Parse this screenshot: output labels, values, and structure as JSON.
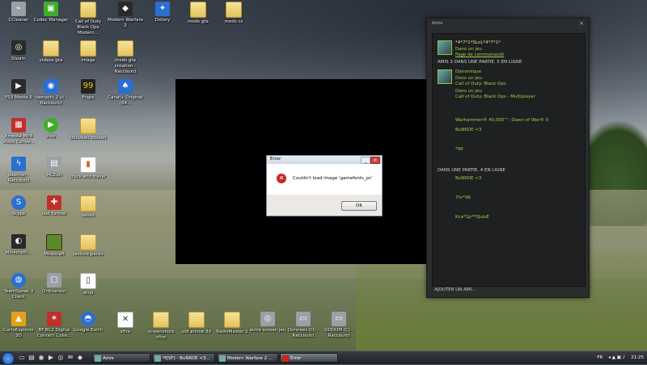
{
  "desktop_icons": [
    {
      "id": "ccleaner",
      "label": "CCleaner",
      "icon": "broom-icon"
    },
    {
      "id": "carboncopy",
      "label": "Codec Manager",
      "icon": "app-icon"
    },
    {
      "id": "cod",
      "label": "Call of Duty Black Ops Modern...",
      "icon": "folder-icon"
    },
    {
      "id": "mw",
      "label": "Modern Warfare 2",
      "icon": "game-icon"
    },
    {
      "id": "dxtory",
      "label": "Dxtory",
      "icon": "app-icon"
    },
    {
      "id": "mods",
      "label": "mods gta",
      "icon": "folder-icon"
    },
    {
      "id": "modcs",
      "label": "mods cs",
      "icon": "folder-icon"
    },
    {
      "id": "steam",
      "label": "Steam",
      "icon": "steam-icon"
    },
    {
      "id": "videos",
      "label": "videos gta",
      "icon": "folder-icon"
    },
    {
      "id": "image",
      "label": "image",
      "icon": "folder-icon"
    },
    {
      "id": "mods_gta_creation",
      "label": "mods gta creation - Raccourci",
      "icon": "folder-icon"
    },
    {
      "id": "ps3",
      "label": "PS3 Media 5",
      "icon": "app-icon"
    },
    {
      "id": "hamachi",
      "label": "hamachi 2 ui - Raccourci",
      "icon": "app-icon"
    },
    {
      "id": "fraps",
      "label": "Fraps",
      "icon": "fraps-icon"
    },
    {
      "id": "canals",
      "label": "Canal+ Original (64...",
      "icon": "app-icon"
    },
    {
      "id": "xmedia",
      "label": "Xmedia MP4 Video Conve...",
      "icon": "app-icon"
    },
    {
      "id": "play",
      "label": "play",
      "icon": "play-icon"
    },
    {
      "id": "nouveau",
      "label": "Nouveau dossier",
      "icon": "folder-icon"
    },
    {
      "id": "daemon",
      "label": "daemon - Raccourci",
      "icon": "app-icon"
    },
    {
      "id": "mcedit",
      "label": "MCEdit",
      "icon": "app-icon"
    },
    {
      "id": "truck",
      "label": "truck and trailer",
      "icon": "file-icon"
    },
    {
      "id": "skype",
      "label": "Skype",
      "icon": "skype-icon"
    },
    {
      "id": "fast",
      "label": "fast farmer",
      "icon": "app-icon"
    },
    {
      "id": "saves",
      "label": "saves",
      "icon": "folder-icon"
    },
    {
      "id": "minecraft_installer",
      "label": "MinecraftI...",
      "icon": "app-icon"
    },
    {
      "id": "minecraft",
      "label": "Minecraft",
      "icon": "minecraft-icon"
    },
    {
      "id": "texture",
      "label": "texture packs",
      "icon": "folder-icon"
    },
    {
      "id": "teamspeak",
      "label": "TeamSpeak 3 Client",
      "icon": "teamspeak-icon"
    },
    {
      "id": "oldnew",
      "label": "Ordinateur",
      "icon": "app-icon"
    },
    {
      "id": "wlnp",
      "label": "wlnp",
      "icon": "file-icon"
    },
    {
      "id": "carto",
      "label": "CartoExplorer 3D",
      "icon": "app-icon"
    },
    {
      "id": "bf",
      "label": "BF:BC2 Digital Content Colle...",
      "icon": "game-icon"
    },
    {
      "id": "google_earth",
      "label": "Google Earth",
      "icon": "earth-icon"
    },
    {
      "id": "xfire",
      "label": "xfire",
      "icon": "xfire-icon"
    },
    {
      "id": "screenshots",
      "label": "screenshots xfire",
      "icon": "folder-icon"
    },
    {
      "id": "old_anime",
      "label": "old anime 3d",
      "icon": "folder-icon"
    },
    {
      "id": "radioman",
      "label": "RadioMaster 1",
      "icon": "folder-icon"
    },
    {
      "id": "autre",
      "label": "autre screen jeu",
      "icon": "app-icon"
    },
    {
      "id": "donnees",
      "label": "Données (D) - Raccourci",
      "icon": "drive-icon"
    },
    {
      "id": "nouveaux",
      "label": "DDDOM (C) - Raccourci",
      "icon": "drive-icon"
    }
  ],
  "dialog": {
    "title": "Error",
    "message": "Couldn't load image 'gamefonts_pc'",
    "ok_label": "OK",
    "close_glyph": "×",
    "min_glyph": "_"
  },
  "friends": {
    "title": "Amis",
    "close_glyph": "×",
    "me": {
      "name": "*4*7*1*SLoL*4*7*1*",
      "status": "Dans un jeu",
      "sub": "Page de communauté"
    },
    "section1": "AMIS  3 DANS UNE PARTIE, 5 EN LIGNE",
    "friend1": {
      "name": "Djoramique",
      "status": "Dans un jeu",
      "game": "Call of Duty: Black Ops"
    },
    "friend2": {
      "game": "Call of Duty: Black Ops - Multiplayer",
      "status": "Dans un jeu"
    },
    "friend3": {
      "game": "Warhammer® 40,000™: Dawn of War® II"
    },
    "friend4": {
      "name": "BuNKOE <3"
    },
    "friend5": {
      "name": "*9K"
    },
    "section2": "DANS UNE PARTIE, 4 EN LIGNE",
    "friend6": {
      "name": "BuNKOE <3"
    },
    "friend7": {
      "name": "7hr*9K"
    },
    "friend8": {
      "name": "Kca*1p**SJuIsE"
    },
    "add_label": "AJOUTER UN AMI..."
  },
  "taskbar": {
    "tasks": [
      {
        "label": "Amis"
      },
      {
        "label": "*f[SF] - BuNKOE <3..."
      },
      {
        "label": "Modern Warfare 2 ..."
      },
      {
        "label": "Error"
      }
    ],
    "lang": "FR",
    "time": "21:25"
  },
  "colors": {
    "accent_green": "#9fd04a",
    "error_red": "#c8261e",
    "panel_bg": "#2b2c2e"
  }
}
